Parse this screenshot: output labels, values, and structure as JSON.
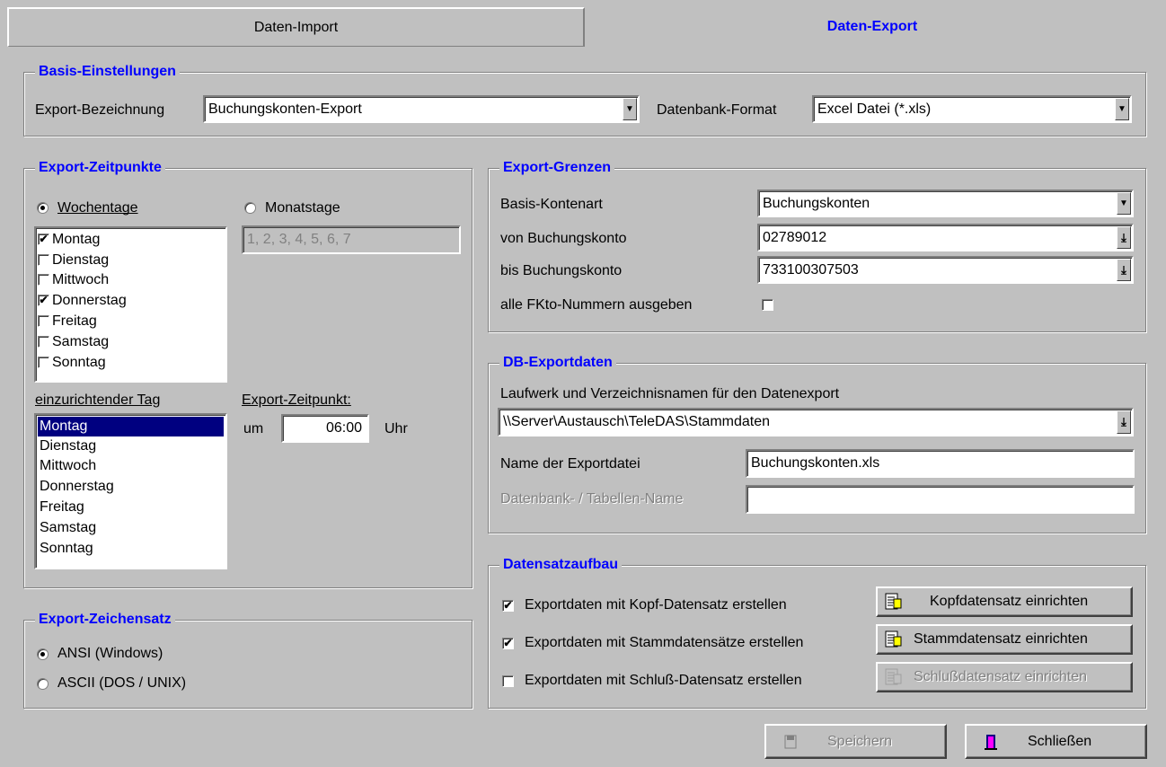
{
  "tabs": {
    "import": "Daten-Import",
    "export": "Daten-Export"
  },
  "basis": {
    "title": "Basis-Einstellungen",
    "export_label": "Export-Bezeichnung",
    "export_value": "Buchungskonten-Export",
    "format_label": "Datenbank-Format",
    "format_value": "Excel Datei (*.xls)"
  },
  "zeitpunkte": {
    "title": "Export-Zeitpunkte",
    "wochentage_label": "Wochentage",
    "monatstage_label": "Monatstage",
    "monatstage_value": "1, 2, 3, 4, 5, 6, 7",
    "days": [
      {
        "label": "Montag",
        "checked": "✔"
      },
      {
        "label": "Dienstag",
        "checked": ""
      },
      {
        "label": "Mittwoch",
        "checked": ""
      },
      {
        "label": "Donnerstag",
        "checked": "✔"
      },
      {
        "label": "Freitag",
        "checked": ""
      },
      {
        "label": "Samstag",
        "checked": ""
      },
      {
        "label": "Sonntag",
        "checked": ""
      }
    ],
    "einzurichtender_label": "einzurichtender Tag",
    "day_list": [
      "Montag",
      "Dienstag",
      "Mittwoch",
      "Donnerstag",
      "Freitag",
      "Samstag",
      "Sonntag"
    ],
    "zeitpunkt_label": "Export-Zeitpunkt:",
    "um_label": "um",
    "time_value": "06:00",
    "uhr_label": "Uhr"
  },
  "zeichensatz": {
    "title": "Export-Zeichensatz",
    "ansi": "ANSI (Windows)",
    "ascii": "ASCII (DOS / UNIX)"
  },
  "grenzen": {
    "title": "Export-Grenzen",
    "kontenart_label": "Basis-Kontenart",
    "kontenart_value": "Buchungskonten",
    "von_label": "von Buchungskonto",
    "von_value": "02789012",
    "bis_label": "bis Buchungskonto",
    "bis_value": "733100307503",
    "alle_label": "alle FKto-Nummern ausgeben"
  },
  "dbexport": {
    "title": "DB-Exportdaten",
    "laufwerk_label": "Laufwerk und Verzeichnisnamen für den Datenexport",
    "path_value": "\\\\Server\\Austausch\\TeleDAS\\Stammdaten",
    "name_label": "Name der Exportdatei",
    "name_value": "Buchungskonten.xls",
    "tabelle_label": "Datenbank- / Tabellen-Name",
    "tabelle_value": ""
  },
  "aufbau": {
    "title": "Datensatzaufbau",
    "kopf_check_label": "Exportdaten mit Kopf-Datensatz erstellen",
    "kopf_button": "Kopfdatensatz einrichten",
    "stamm_check_label": "Exportdaten mit Stammdatensätze erstellen",
    "stamm_button": "Stammdatensatz einrichten",
    "schluss_check_label": "Exportdaten mit Schluß-Datensatz erstellen",
    "schluss_button": "Schlußdatensatz einrichten",
    "kopf_checked": "✔",
    "stamm_checked": "✔",
    "schluss_checked": ""
  },
  "footer": {
    "save": "Speichern",
    "close": "Schließen"
  }
}
